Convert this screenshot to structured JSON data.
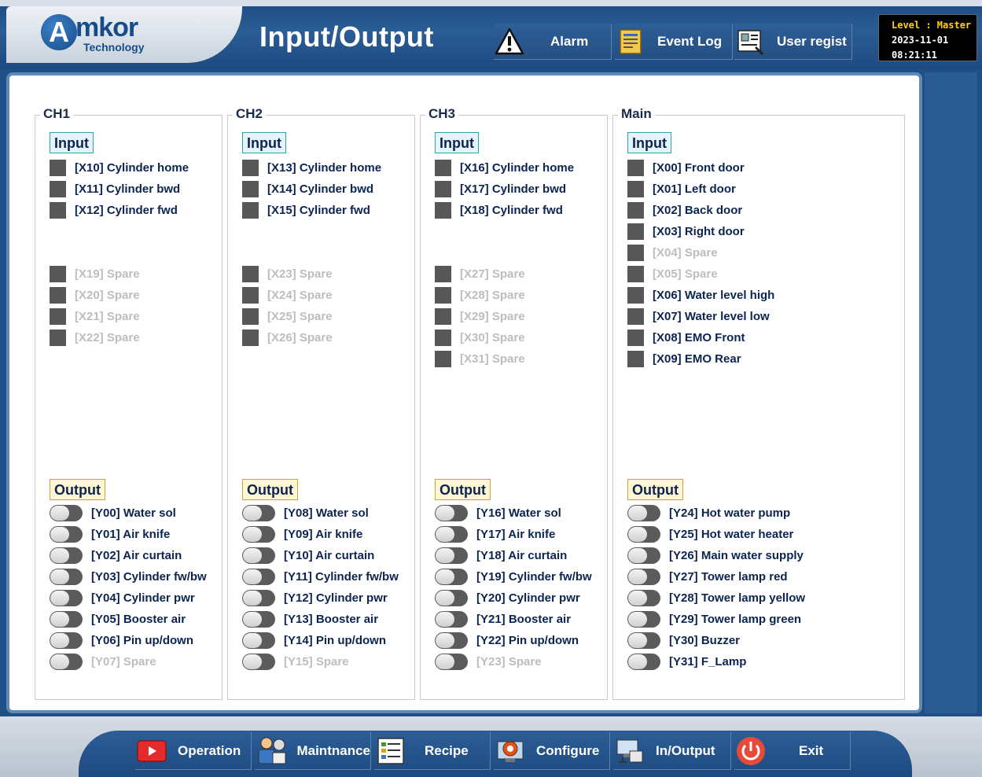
{
  "header": {
    "logo_mark": "A",
    "logo_text": "mkor",
    "logo_sub": "Technology",
    "title": "Input/Output",
    "alarm_label": "Alarm",
    "eventlog_label": "Event Log",
    "userregist_label": "User regist",
    "status": {
      "level": "Level : Master",
      "date": "2023-11-01",
      "time": "08:21:11"
    }
  },
  "section_labels": {
    "input": "Input",
    "output": "Output"
  },
  "panels": [
    {
      "title": "CH1",
      "inputs": [
        {
          "label": "[X10] Cylinder home",
          "spare": false
        },
        {
          "label": "[X11] Cylinder bwd",
          "spare": false
        },
        {
          "label": "[X12] Cylinder fwd",
          "spare": false
        },
        {
          "label": "[X19] Spare",
          "spare": true
        },
        {
          "label": "[X20] Spare",
          "spare": true
        },
        {
          "label": "[X21] Spare",
          "spare": true
        },
        {
          "label": "[X22] Spare",
          "spare": true
        }
      ],
      "outputs": [
        {
          "label": "[Y00] Water sol",
          "spare": false
        },
        {
          "label": "[Y01] Air knife",
          "spare": false
        },
        {
          "label": "[Y02] Air curtain",
          "spare": false
        },
        {
          "label": "[Y03] Cylinder fw/bw",
          "spare": false
        },
        {
          "label": "[Y04] Cylinder pwr",
          "spare": false
        },
        {
          "label": "[Y05] Booster air",
          "spare": false
        },
        {
          "label": "[Y06] Pin up/down",
          "spare": false
        },
        {
          "label": "[Y07] Spare",
          "spare": true
        }
      ]
    },
    {
      "title": "CH2",
      "inputs": [
        {
          "label": "[X13] Cylinder home",
          "spare": false
        },
        {
          "label": "[X14] Cylinder bwd",
          "spare": false
        },
        {
          "label": "[X15] Cylinder fwd",
          "spare": false
        },
        {
          "label": "[X23] Spare",
          "spare": true
        },
        {
          "label": "[X24] Spare",
          "spare": true
        },
        {
          "label": "[X25] Spare",
          "spare": true
        },
        {
          "label": "[X26] Spare",
          "spare": true
        }
      ],
      "outputs": [
        {
          "label": "[Y08] Water sol",
          "spare": false
        },
        {
          "label": "[Y09] Air knife",
          "spare": false
        },
        {
          "label": "[Y10] Air curtain",
          "spare": false
        },
        {
          "label": "[Y11] Cylinder fw/bw",
          "spare": false
        },
        {
          "label": "[Y12] Cylinder pwr",
          "spare": false
        },
        {
          "label": "[Y13] Booster air",
          "spare": false
        },
        {
          "label": "[Y14] Pin up/down",
          "spare": false
        },
        {
          "label": "[Y15] Spare",
          "spare": true
        }
      ]
    },
    {
      "title": "CH3",
      "inputs": [
        {
          "label": "[X16] Cylinder home",
          "spare": false
        },
        {
          "label": "[X17] Cylinder bwd",
          "spare": false
        },
        {
          "label": "[X18] Cylinder fwd",
          "spare": false
        },
        {
          "label": "[X27] Spare",
          "spare": true
        },
        {
          "label": "[X28] Spare",
          "spare": true
        },
        {
          "label": "[X29] Spare",
          "spare": true
        },
        {
          "label": "[X30] Spare",
          "spare": true
        },
        {
          "label": "[X31] Spare",
          "spare": true
        }
      ],
      "outputs": [
        {
          "label": "[Y16] Water sol",
          "spare": false
        },
        {
          "label": "[Y17] Air knife",
          "spare": false
        },
        {
          "label": "[Y18] Air curtain",
          "spare": false
        },
        {
          "label": "[Y19] Cylinder fw/bw",
          "spare": false
        },
        {
          "label": "[Y20] Cylinder pwr",
          "spare": false
        },
        {
          "label": "[Y21] Booster air",
          "spare": false
        },
        {
          "label": "[Y22] Pin up/down",
          "spare": false
        },
        {
          "label": "[Y23] Spare",
          "spare": true
        }
      ]
    },
    {
      "title": "Main",
      "inputs": [
        {
          "label": "[X00] Front door",
          "spare": false
        },
        {
          "label": "[X01] Left door",
          "spare": false
        },
        {
          "label": "[X02] Back door",
          "spare": false
        },
        {
          "label": "[X03] Right door",
          "spare": false
        },
        {
          "label": "[X04] Spare",
          "spare": true
        },
        {
          "label": "[X05] Spare",
          "spare": true
        },
        {
          "label": "[X06] Water level high",
          "spare": false
        },
        {
          "label": "[X07] Water level low",
          "spare": false
        },
        {
          "label": "[X08] EMO Front",
          "spare": false
        },
        {
          "label": "[X09] EMO Rear",
          "spare": false
        }
      ],
      "outputs": [
        {
          "label": "[Y24] Hot water pump",
          "spare": false
        },
        {
          "label": "[Y25] Hot water heater",
          "spare": false
        },
        {
          "label": "[Y26] Main water supply",
          "spare": false
        },
        {
          "label": "[Y27] Tower lamp red",
          "spare": false
        },
        {
          "label": "[Y28] Tower lamp yellow",
          "spare": false
        },
        {
          "label": "[Y29] Tower lamp green",
          "spare": false
        },
        {
          "label": "[Y30] Buzzer",
          "spare": false
        },
        {
          "label": "[Y31] F_Lamp",
          "spare": false
        }
      ]
    }
  ],
  "footer": {
    "operation": "Operation",
    "maintnance": "Maintnance",
    "recipe": "Recipe",
    "configure": "Configure",
    "inoutput": "In/Output",
    "exit": "Exit"
  }
}
